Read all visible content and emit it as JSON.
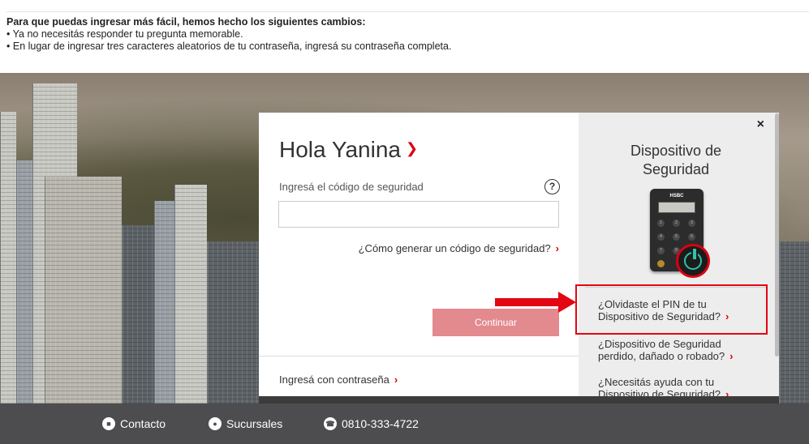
{
  "notice": {
    "title": "Para que puedas ingresar más fácil, hemos hecho los siguientes cambios:",
    "items": [
      "Ya no necesitás responder tu pregunta memorable.",
      "En lugar de ingresar tres caracteres aleatorios de tu contraseña, ingresá su contraseña completa."
    ]
  },
  "login": {
    "greeting": "Hola Yanina",
    "security_code_label": "Ingresá el código de seguridad",
    "security_code_value": "",
    "how_to_generate_link": "¿Cómo generar un código de seguridad?",
    "continue_button": "Continuar",
    "password_link": "Ingresá con contraseña"
  },
  "side_panel": {
    "close_label": "×",
    "title_line1": "Dispositivo de",
    "title_line2": "Seguridad",
    "device_brand": "HSBC",
    "links": [
      {
        "line1": "¿Olvidaste el PIN de tu",
        "line2": "Dispositivo de Seguridad?"
      },
      {
        "line1": "¿Dispositivo de Seguridad",
        "line2": "perdido, dañado o robado?"
      },
      {
        "line1": "¿Necesitás ayuda con tu",
        "line2": "Dispositivo de Seguridad?"
      }
    ]
  },
  "footer": {
    "contact": "Contacto",
    "branches": "Sucursales",
    "phone": "0810-333-4722"
  },
  "colors": {
    "brand_red": "#db0011",
    "button_disabled": "#e38a8f",
    "footer_bg": "#4d4d4f",
    "highlight": "#e30613"
  }
}
